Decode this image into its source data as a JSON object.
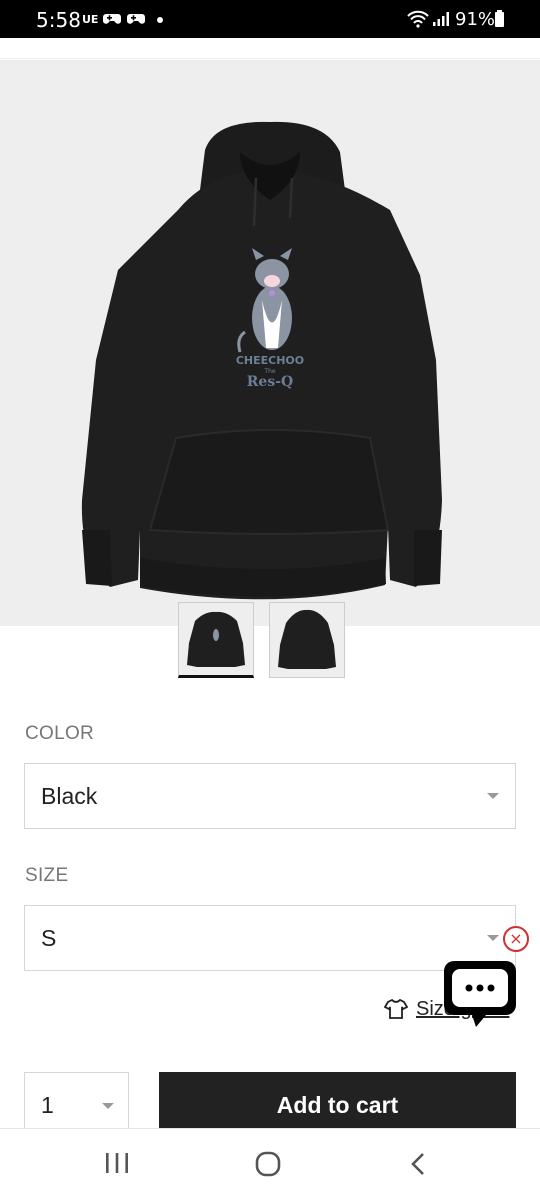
{
  "status_bar": {
    "time": "5:58",
    "carrier": "UE",
    "battery": "91%"
  },
  "product": {
    "print_title": "CHEECHOO",
    "print_the": "The",
    "print_subtitle": "Res-Q"
  },
  "options": {
    "color_label": "COLOR",
    "color_value": "Black",
    "size_label": "SIZE",
    "size_value": "S",
    "size_guide_label": "Size guide"
  },
  "cart": {
    "quantity": "1",
    "add_to_cart_label": "Add to cart"
  },
  "close_badge": "×",
  "colors": {
    "hoodie": "#1f1f1f",
    "button": "#222222",
    "background": "#eeeeee",
    "close_red": "#d32f2f"
  },
  "icons": {
    "status": [
      "game-controller-icon",
      "wifi-icon",
      "signal-icon",
      "battery-icon"
    ],
    "size_guide": "tshirt-icon",
    "chat": "chat-bubble-icon",
    "nav": [
      "recent-apps-icon",
      "home-icon",
      "back-icon"
    ]
  }
}
